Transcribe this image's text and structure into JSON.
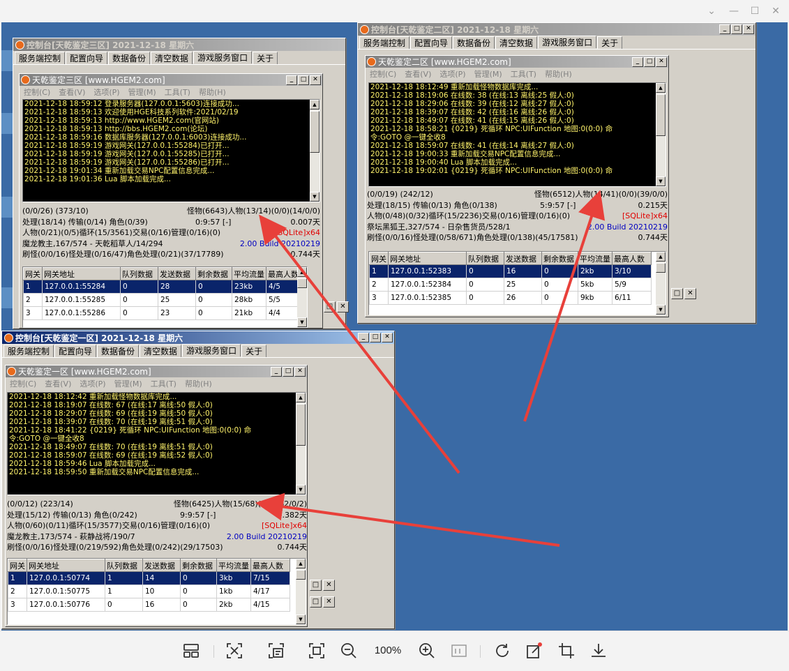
{
  "viewer": {
    "zoom": "100%",
    "toolbar_icons": [
      "layout-icon",
      "fit-icon",
      "ocr-icon",
      "fullscreen-icon",
      "zoom-out-icon",
      "zoom-in-icon",
      "actual-size-icon",
      "rotate-icon",
      "edit-icon",
      "crop-icon",
      "download-icon"
    ]
  },
  "tabs": [
    "服务端控制",
    "配置向导",
    "数据备份",
    "清空数据",
    "游戏服务窗口",
    "关于"
  ],
  "menus": [
    "控制(C)",
    "查看(V)",
    "选项(P)",
    "管理(M)",
    "工具(T)",
    "帮助(H)"
  ],
  "grid_headers": [
    "网关",
    "网关地址",
    "队列数据",
    "发送数据",
    "剩余数据",
    "平均流量",
    "最高人数"
  ],
  "windows": {
    "zone3": {
      "title": "控制台[天乾鉴定三区] 2021-12-18 星期六",
      "inner_title": "天乾鉴定三区 [www.HGEM2.com]",
      "log": [
        "2021-12-18 18:59:12 登录服务器(127.0.0.1:5603)连接成功...",
        "2021-12-18 18:59:13 欢迎使用HGE科技系列软件:2021/02/19",
        "2021-12-18 18:59:13 http://www.HGEM2.com(官网站)",
        "2021-12-18 18:59:13 http://bbs.HGEM2.com(论坛)",
        "2021-12-18 18:59:16 数据库服务器(127.0.0.1:6003)连接成功...",
        "2021-12-18 18:59:19 游戏网关(127.0.0.1:55284)已打开...",
        "2021-12-18 18:59:19 游戏网关(127.0.0.1:55285)已打开...",
        "2021-12-18 18:59:19 游戏网关(127.0.0.1:55286)已打开...",
        "2021-12-18 19:01:34 重新加载交易NPC配置信息完成...",
        "2021-12-18 19:01:36 Lua 脚本加载完成..."
      ],
      "stats": {
        "l1": "(0/0/26) (373/10)",
        "r1": "怪物(6643)人物(13/14)(0/0)(14/0/0)",
        "l2": "处理(18/14) 传输(0/14) 角色(0/39)",
        "m2": "0:9:57 [-]",
        "r2": "0.007天",
        "l3": "人物(0/21)(0/5)循环(15/3561)交易(0/16)管理(0/16)(0)",
        "r3": "[SQLite]x64",
        "l4": "魔龙教主,167/574 - 天乾稻草人/14/294",
        "r4": "2.00 Build 20210219",
        "l5": "刷怪(0/0/16)怪处理(0/16/47)角色处理(0/21)(37/17789)",
        "r5": "0.744天"
      },
      "rows": [
        [
          "1",
          "127.0.0.1:55284",
          "0",
          "28",
          "0",
          "23kb",
          "4/5"
        ],
        [
          "2",
          "127.0.0.1:55285",
          "0",
          "25",
          "0",
          "28kb",
          "5/5"
        ],
        [
          "3",
          "127.0.0.1:55286",
          "0",
          "23",
          "0",
          "21kb",
          "4/4"
        ]
      ]
    },
    "zone2": {
      "title": "控制台[天乾鉴定二区] 2021-12-18 星期六",
      "inner_title": "天乾鉴定二区 [www.HGEM2.com]",
      "log": [
        "2021-12-18 18:12:49 重新加载怪物数据库完成...",
        "2021-12-18 18:19:06 在线数: 38 (在线:13 离线:25 假人:0)",
        "2021-12-18 18:29:06 在线数: 39 (在线:12 离线:27 假人:0)",
        "2021-12-18 18:39:07 在线数: 42 (在线:16 离线:26 假人:0)",
        "2021-12-18 18:49:07 在线数: 41 (在线:15 离线:26 假人:0)",
        "2021-12-18 18:58:21 {0219} 死循环 NPC:UIFunction 地图:0(0:0) 命",
        "令:GOTO @一键全收8",
        "2021-12-18 18:59:07 在线数: 41 (在线:14 离线:27 假人:0)",
        "2021-12-18 19:00:33 重新加载交易NPC配置信息完成...",
        "2021-12-18 19:00:40 Lua 脚本加载完成...",
        "2021-12-18 19:02:01 {0219} 死循环 NPC:UIFunction 地图:0(0:0) 命"
      ],
      "stats": {
        "l1": "(0/0/19) (242/12)",
        "r1": "怪物(6512)人物(14/41)(0/0)(39/0/0)",
        "l2": "处理(18/15) 传输(0/13) 角色(0/138)",
        "m2": "5:9:57 [-]",
        "r2": "0.215天",
        "l3": "人物(0/48)(0/32)循环(15/2236)交易(0/16)管理(0/16)(0)",
        "r3": "[SQLite]x64",
        "l4": "祭坛黑狐王,327/574 - 日杂售货员/528/1",
        "r4": "2.00 Build 20210219",
        "l5": "刷怪(0/0/16)怪处理(0/58/671)角色处理(0/138)(45/17581)",
        "r5": "0.744天"
      },
      "rows": [
        [
          "1",
          "127.0.0.1:52383",
          "0",
          "16",
          "0",
          "2kb",
          "3/10"
        ],
        [
          "2",
          "127.0.0.1:52384",
          "0",
          "25",
          "0",
          "5kb",
          "5/9"
        ],
        [
          "3",
          "127.0.0.1:52385",
          "0",
          "26",
          "0",
          "9kb",
          "6/11"
        ]
      ]
    },
    "zone1": {
      "title": "控制台[天乾鉴定一区] 2021-12-18 星期六",
      "inner_title": "天乾鉴定一区 [www.HGEM2.com]",
      "log": [
        "2021-12-18 18:12:42 重新加载怪物数据库完成...",
        "2021-12-18 18:19:07 在线数: 67 (在线:17 离线:50 假人:0)",
        "2021-12-18 18:29:07 在线数: 69 (在线:19 离线:50 假人:0)",
        "2021-12-18 18:39:07 在线数: 70 (在线:19 离线:51 假人:0)",
        "2021-12-18 18:41:22 {0219} 死循环 NPC:UIFunction 地图:0(0:0) 命",
        "令:GOTO @一键全收8",
        "2021-12-18 18:49:07 在线数: 70 (在线:19 离线:51 假人:0)",
        "2021-12-18 18:59:07 在线数: 69 (在线:19 离线:52 假人:0)",
        "2021-12-18 18:59:46 Lua 脚本加载完成...",
        "2021-12-18 18:59:50 重新加载交易NPC配置信息完成..."
      ],
      "stats": {
        "l1": "(0/0/12) (223/14)",
        "r1": "怪物(6425)人物(15/68)(0/0)(62/0/2)",
        "l2": "处理(15/12) 传输(0/13) 角色(0/242)",
        "m2": "9:9:57 [-]",
        "r2": "0.382天",
        "l3": "人物(0/60)(0/11)循环(15/3577)交易(0/16)管理(0/16)(0)",
        "r3": "[SQLite]x64",
        "l4": "魔龙教主,173/574 - 萩静战将/190/7",
        "r4": "2.00 Build 20210219",
        "l5": "刷怪(0/0/16)怪处理(0/219/592)角色处理(0/242)(29/17503)",
        "r5": "0.744天"
      },
      "rows": [
        [
          "1",
          "127.0.0.1:50774",
          "1",
          "14",
          "0",
          "3kb",
          "7/15"
        ],
        [
          "2",
          "127.0.0.1:50775",
          "1",
          "10",
          "0",
          "1kb",
          "4/17"
        ],
        [
          "3",
          "127.0.0.1:50776",
          "0",
          "16",
          "0",
          "2kb",
          "4/15"
        ]
      ]
    }
  },
  "colors": {
    "desktop": "#3a6aa5",
    "active_title": "#0a246a",
    "log_text": "#fff36b",
    "arrow": "#e8403a",
    "sqlite": "#e00000",
    "build": "#0000c0"
  }
}
